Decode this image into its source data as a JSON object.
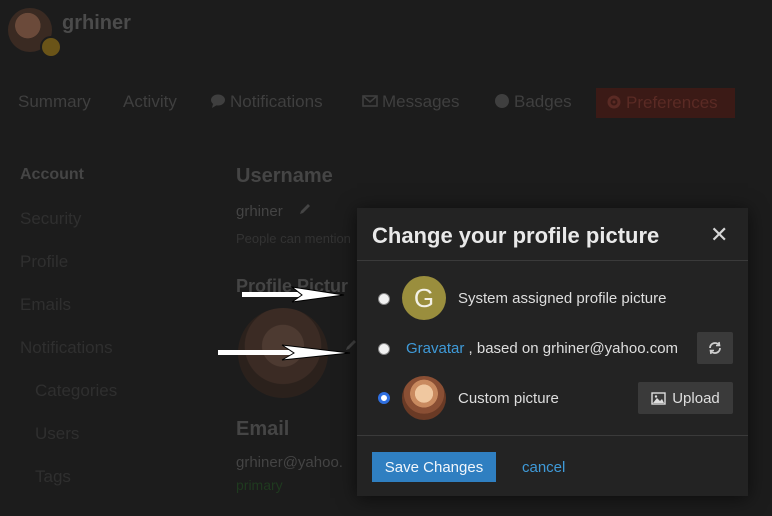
{
  "header": {
    "username": "grhiner"
  },
  "nav": {
    "summary": "Summary",
    "activity": "Activity",
    "notifications": "Notifications",
    "messages": "Messages",
    "badges": "Badges",
    "preferences": "Preferences"
  },
  "sidebar": {
    "account": "Account",
    "security": "Security",
    "profile": "Profile",
    "emails": "Emails",
    "notifications": "Notifications",
    "categories": "Categories",
    "users": "Users",
    "tags": "Tags"
  },
  "main": {
    "username_heading": "Username",
    "username_value": "grhiner",
    "username_hint": "People can mention",
    "profile_picture_heading": "Profile Pictur",
    "email_heading": "Email",
    "email_value": "grhiner@yahoo.",
    "email_status": "primary"
  },
  "modal": {
    "title": "Change your profile picture",
    "close": "✕",
    "options": {
      "system": {
        "avatar_letter": "G",
        "label": "System assigned profile picture"
      },
      "gravatar": {
        "link": "Gravatar",
        "label": " , based on grhiner@yahoo.com"
      },
      "custom": {
        "label": "Custom picture",
        "upload": "Upload"
      }
    },
    "save": "Save Changes",
    "cancel": "cancel"
  },
  "colors": {
    "accent": "#2f7fc1",
    "link": "#3f9ad8",
    "modal_bg": "#232323",
    "page_bg": "#1c1c1c"
  }
}
